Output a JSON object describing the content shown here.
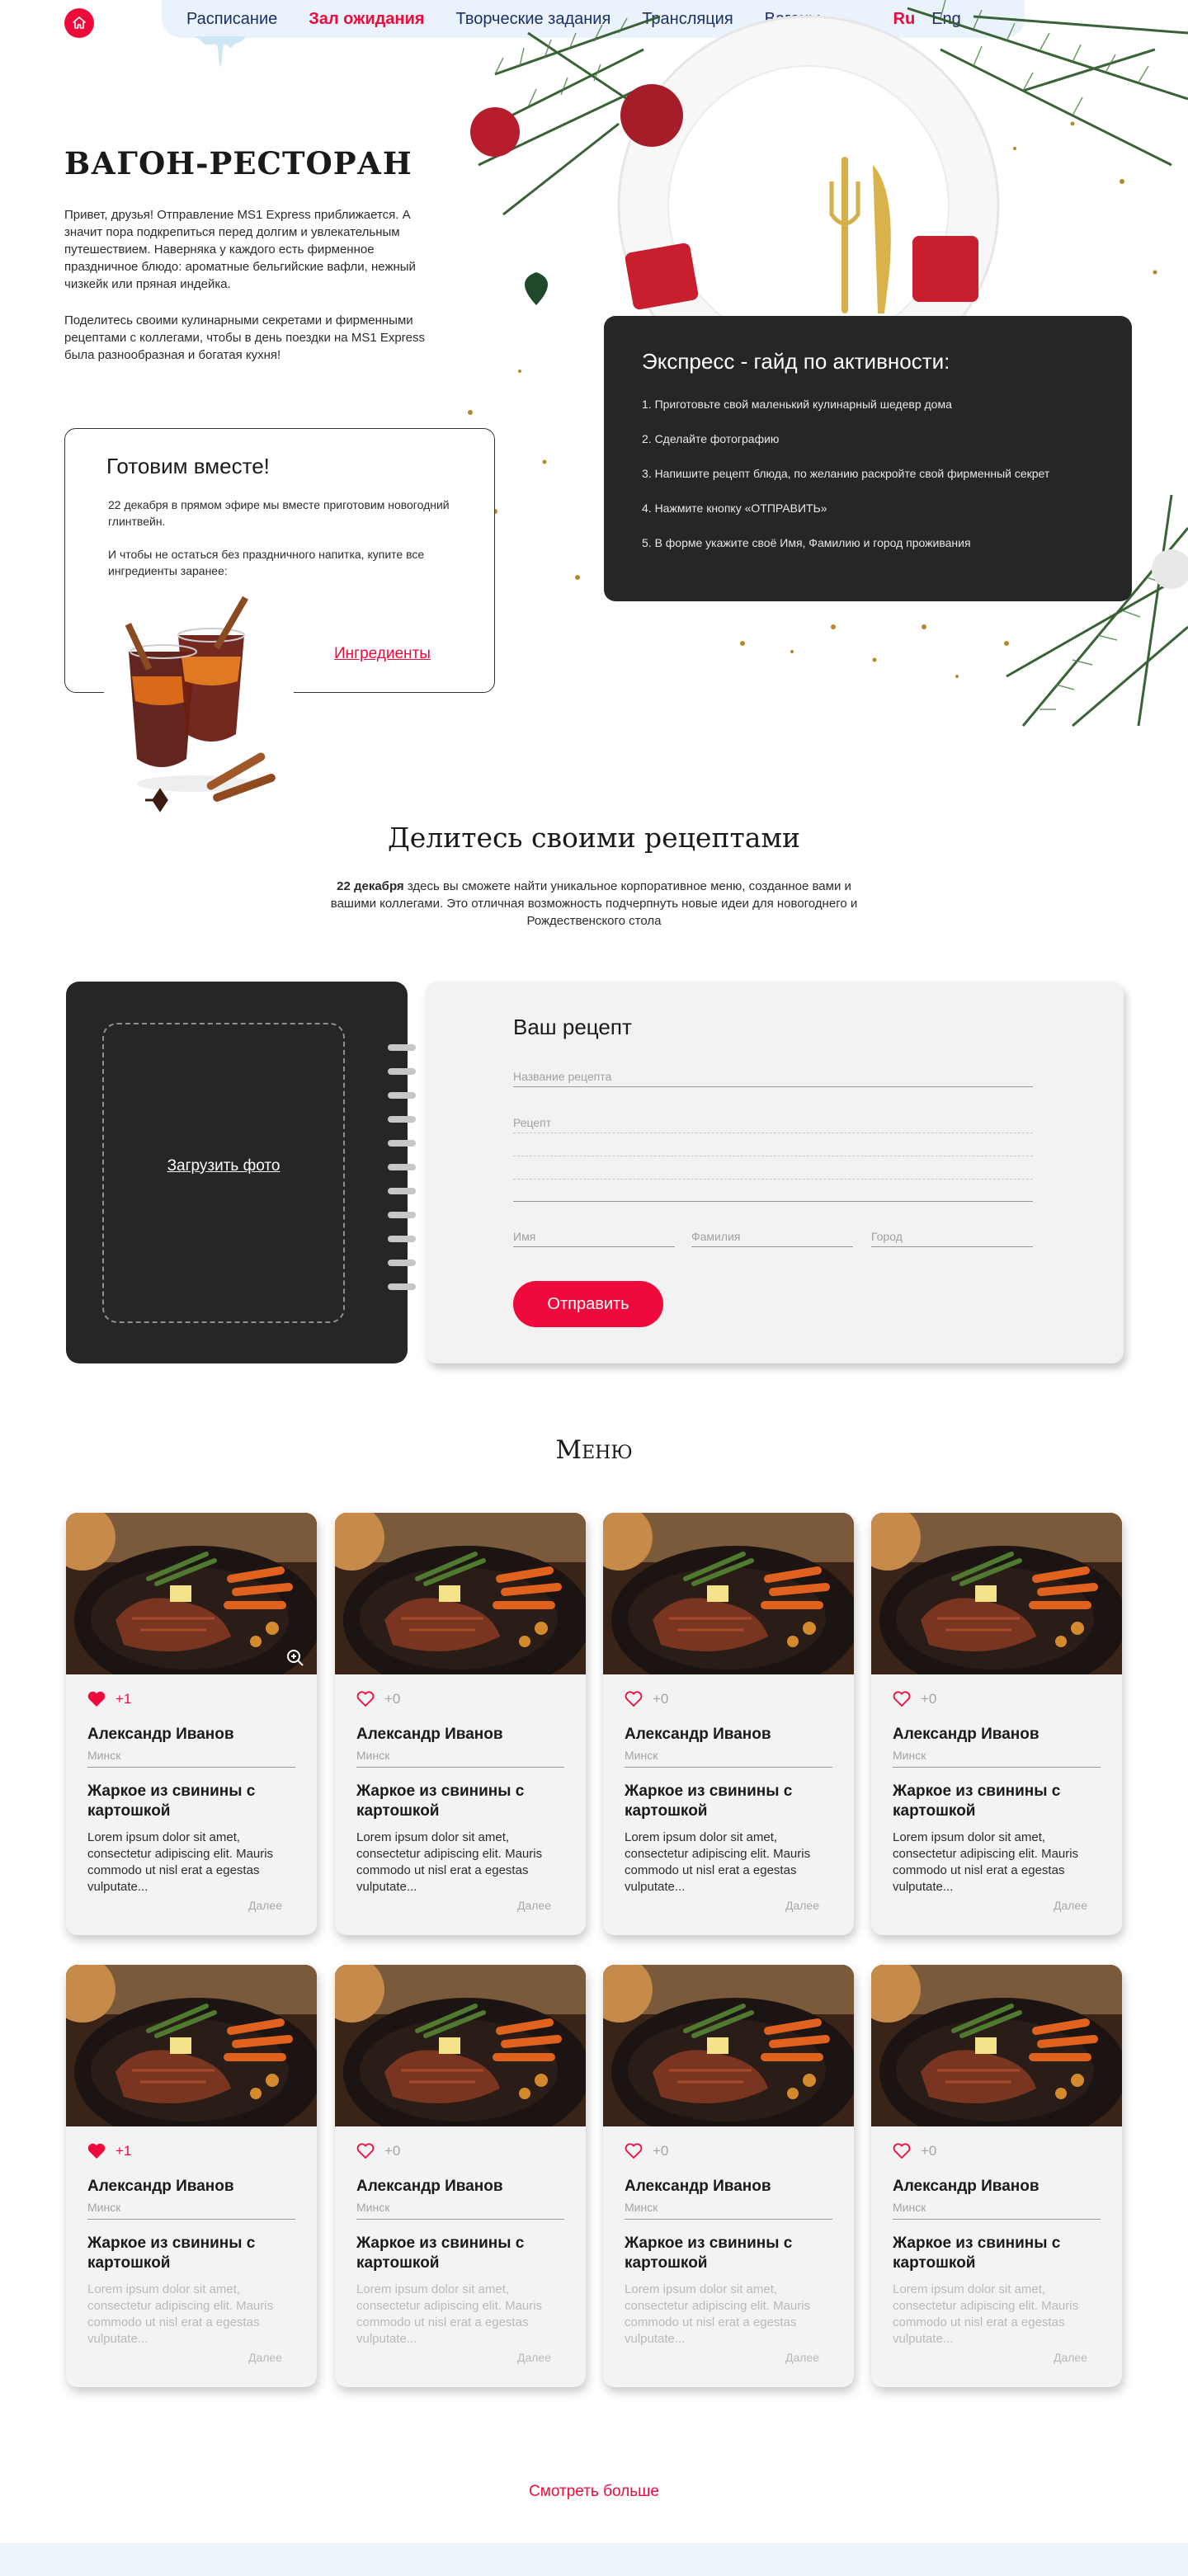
{
  "nav": {
    "items": [
      "Расписание",
      "Зал ожидания",
      "Творческие задания",
      "Трансляция",
      "Вагоны"
    ],
    "active_index": 1,
    "languages": [
      "Ru",
      "Eng"
    ],
    "active_language": "Ru"
  },
  "hero": {
    "title": "ВАГОН-РЕСТОРАН",
    "paragraph1": "Привет, друзья! Отправление MS1 Express приближается. А значит пора подкрепиться перед долгим и увлекательным путешествием. Наверняка у каждого есть фирменное праздничное блюдо: ароматные бельгийские вафли, нежный чизкейк или пряная индейка.",
    "paragraph2": "Поделитесь своими кулинарными секретами и фирменными рецептами с коллегами, чтобы в день поездки на MS1 Express была разнообразная и богатая кухня!"
  },
  "guide": {
    "title": "Экспресс - гайд по активности:",
    "steps": [
      "1. Приготовьте свой маленький кулинарный шедевр дома",
      "2.  Сделайте фотографию",
      "3. Напишите рецепт блюда, по желанию раскройте свой фирменный секрет",
      "4. Нажмите кнопку «ОТПРАВИТЬ»",
      "5. В форме укажите своё Имя, Фамилию и город проживания"
    ]
  },
  "together": {
    "title": "Готовим вместе!",
    "text1": "22 декабря в прямом эфире мы вместе приготовим новогодний глинтвейн.",
    "text2": "И чтобы не остаться без праздничного напитка, купите все ингредиенты заранее:",
    "link": "Ингредиенты"
  },
  "share": {
    "title": "Делитесь своими рецептами",
    "date": "22 декабря",
    "text": " здесь вы сможете найти уникальное корпоративное меню, созданное вами и вашими коллегами.  Это отличная возможность подчерпнуть новые идеи для новогоднего и Рождественского стола"
  },
  "recipe_form": {
    "upload_label": "Загрузить фото",
    "title": "Ваш рецепт",
    "name_placeholder": "Название рецепта",
    "recipe_placeholder": "Рецепт",
    "first_name_placeholder": "Имя",
    "last_name_placeholder": "Фамилия",
    "city_placeholder": "Город",
    "submit_label": "Отправить"
  },
  "menu": {
    "title": "Меню",
    "cards": [
      {
        "likes": "+1",
        "liked": true,
        "author": "Александр Иванов",
        "city": "Минск",
        "dish": "Жаркое из свинины с картошкой",
        "desc": "Lorem ipsum dolor sit amet, consectetur adipiscing elit. Mauris commodo ut nisl erat a egestas vulputate...",
        "more": "Далее"
      },
      {
        "likes": "+0",
        "liked": false,
        "author": "Александр Иванов",
        "city": "Минск",
        "dish": "Жаркое из свинины с картошкой",
        "desc": "Lorem ipsum dolor sit amet, consectetur adipiscing elit. Mauris commodo ut nisl erat a egestas vulputate...",
        "more": "Далее"
      },
      {
        "likes": "+0",
        "liked": false,
        "author": "Александр Иванов",
        "city": "Минск",
        "dish": "Жаркое из свинины с картошкой",
        "desc": "Lorem ipsum dolor sit amet, consectetur adipiscing elit. Mauris commodo ut nisl erat a egestas vulputate...",
        "more": "Далее"
      },
      {
        "likes": "+0",
        "liked": false,
        "author": "Александр Иванов",
        "city": "Минск",
        "dish": "Жаркое из свинины с картошкой",
        "desc": "Lorem ipsum dolor sit amet, consectetur adipiscing elit. Mauris commodo ut nisl erat a egestas vulputate...",
        "more": "Далее"
      },
      {
        "likes": "+1",
        "liked": true,
        "author": "Александр Иванов",
        "city": "Минск",
        "dish": "Жаркое из свинины с картошкой",
        "desc": "Lorem ipsum dolor sit amet, consectetur adipiscing elit. Mauris commodo ut nisl erat a egestas vulputate...",
        "more": "Далее"
      },
      {
        "likes": "+0",
        "liked": false,
        "author": "Александр Иванов",
        "city": "Минск",
        "dish": "Жаркое из свинины с картошкой",
        "desc": "Lorem ipsum dolor sit amet, consectetur adipiscing elit. Mauris commodo ut nisl erat a egestas vulputate...",
        "more": "Далее"
      },
      {
        "likes": "+0",
        "liked": false,
        "author": "Александр Иванов",
        "city": "Минск",
        "dish": "Жаркое из свинины с картошкой",
        "desc": "Lorem ipsum dolor sit amet, consectetur adipiscing elit. Mauris commodo ut nisl erat a egestas vulputate...",
        "more": "Далее"
      },
      {
        "likes": "+0",
        "liked": false,
        "author": "Александр Иванов",
        "city": "Минск",
        "dish": "Жаркое из свинины с картошкой",
        "desc": "Lorem ipsum dolor sit amet, consectetur adipiscing elit. Mauris commodo ut nisl erat a egestas vulputate...",
        "more": "Далее"
      }
    ],
    "see_more": "Смотреть больше"
  },
  "colors": {
    "accent": "#f00a3c",
    "nav_bg": "#eaf3fb",
    "dark": "#272626",
    "nav_text": "#1c2f6b"
  },
  "icons": [
    "home-icon",
    "heart-icon",
    "zoom-icon"
  ]
}
